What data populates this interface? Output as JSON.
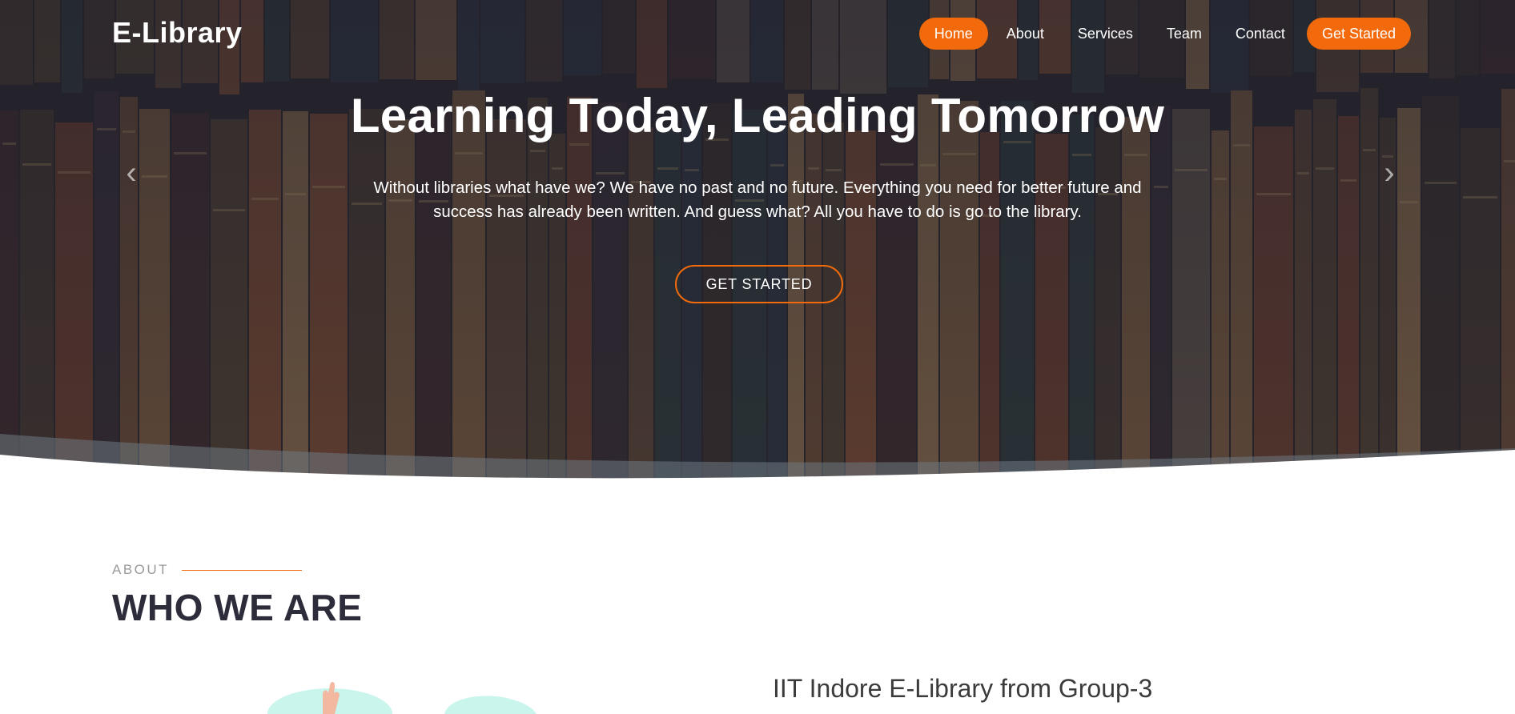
{
  "header": {
    "logo": "E-Library",
    "nav": [
      {
        "label": "Home",
        "active": true
      },
      {
        "label": "About"
      },
      {
        "label": "Services"
      },
      {
        "label": "Team"
      },
      {
        "label": "Contact"
      },
      {
        "label": "Get Started",
        "cta": true
      }
    ]
  },
  "hero": {
    "title": "Learning Today, Leading Tomorrow",
    "text": "Without libraries what have we? We have no past and no future. Everything you need for better future and success has already been written. And guess what? All you have to do is go to the library.",
    "button": "GET STARTED",
    "prev_icon": "chevron-left-icon",
    "next_icon": "chevron-right-icon"
  },
  "about": {
    "label": "ABOUT",
    "heading": "WHO WE ARE",
    "subheading": "IIT Indore E-Library from Group-3"
  },
  "colors": {
    "accent": "#f26a0b",
    "heading": "#2c2c3a",
    "illustration": "#c9f5ec"
  }
}
